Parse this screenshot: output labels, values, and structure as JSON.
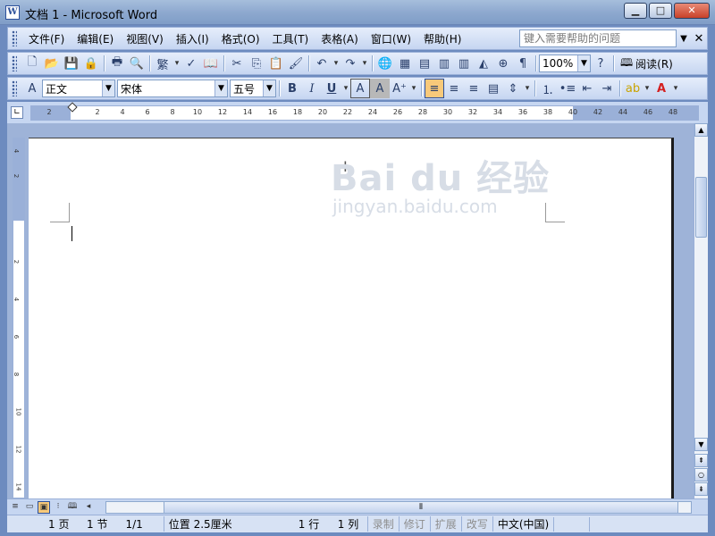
{
  "window": {
    "title": "文档 1 - Microsoft Word"
  },
  "menubar": {
    "items": [
      "文件(F)",
      "编辑(E)",
      "视图(V)",
      "插入(I)",
      "格式(O)",
      "工具(T)",
      "表格(A)",
      "窗口(W)",
      "帮助(H)"
    ],
    "help_placeholder": "键入需要帮助的问题"
  },
  "toolbar_standard": {
    "icons": [
      "new-icon",
      "open-icon",
      "save-icon",
      "permission-icon",
      "print-icon",
      "print-preview-icon",
      "research-icon",
      "spelling-icon",
      "cut-icon",
      "copy-icon",
      "paste-icon",
      "format-painter-icon",
      "undo-icon",
      "redo-icon",
      "hyperlink-icon",
      "tables-borders-icon",
      "insert-table-icon",
      "insert-excel-icon",
      "columns-icon",
      "drawing-icon",
      "document-map-icon",
      "show-hide-icon"
    ],
    "zoom": "100%",
    "read_label": "阅读(R)"
  },
  "toolbar_format": {
    "style": "正文",
    "font": "宋体",
    "size": "五号",
    "buttons": [
      "B",
      "I",
      "U",
      "A",
      "A"
    ]
  },
  "ruler": {
    "h_ticks": [
      "2",
      "2",
      "4",
      "6",
      "8",
      "10",
      "12",
      "14",
      "16",
      "18",
      "20",
      "22",
      "24",
      "26",
      "28",
      "30",
      "32",
      "34",
      "36",
      "38",
      "40",
      "42",
      "44",
      "46",
      "48"
    ],
    "v_ticks": [
      "4",
      "2",
      "2",
      "4",
      "6",
      "8",
      "10",
      "12",
      "14"
    ]
  },
  "document": {
    "watermark": "Bai du 经验",
    "watermark_sub": "jingyan.baidu.com"
  },
  "statusbar": {
    "page": "1 页",
    "section": "1 节",
    "page_of": "1/1",
    "position": "位置 2.5厘米",
    "line": "1 行",
    "column": "1 列",
    "rec": "录制",
    "trk": "修订",
    "ext": "扩展",
    "ovr": "改写",
    "language": "中文(中国)"
  }
}
